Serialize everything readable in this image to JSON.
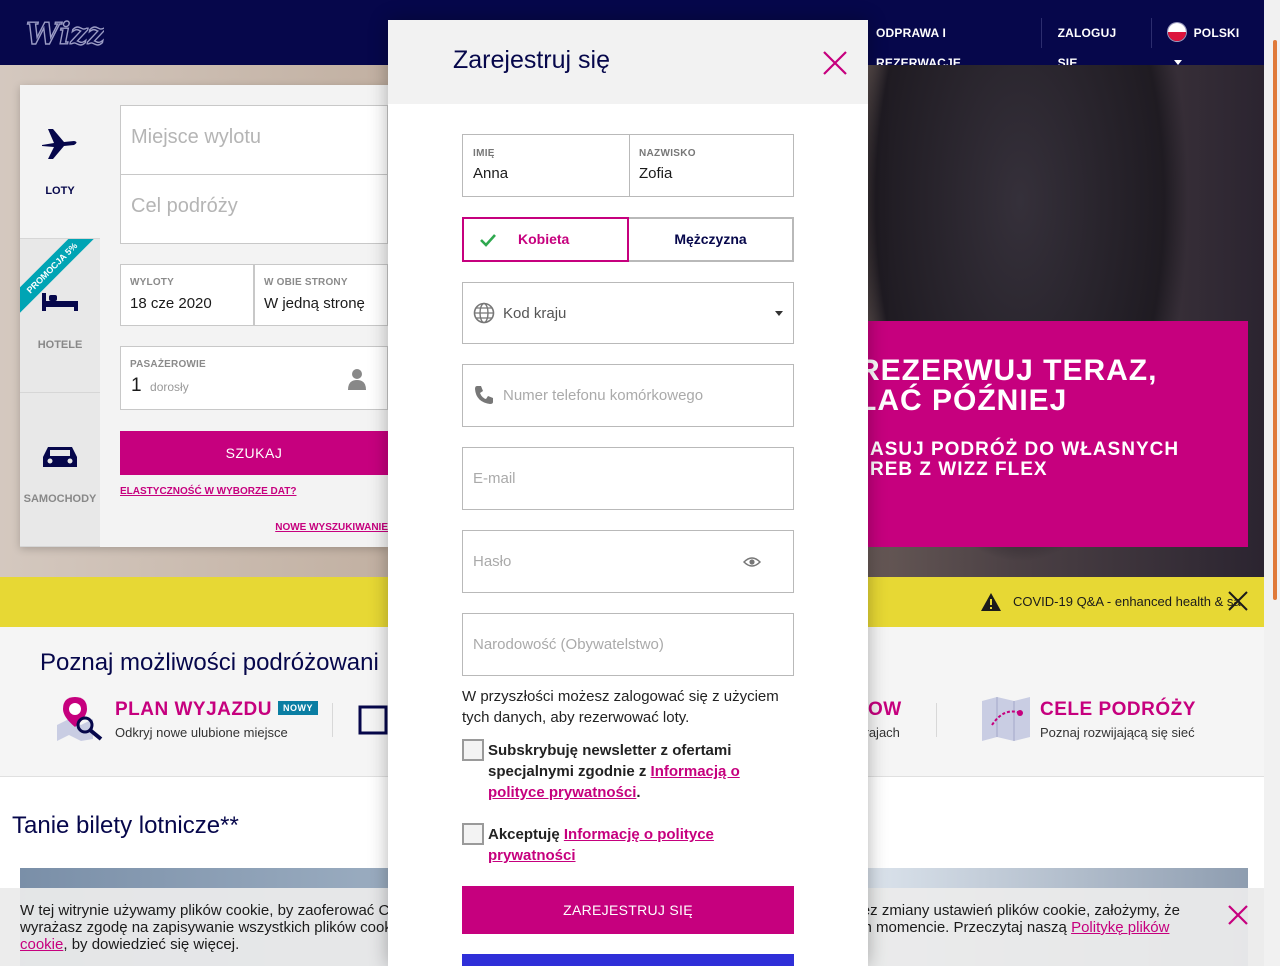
{
  "header": {
    "logo": "WIZZ",
    "nav": [
      "ODPRAWA I REZERWACJE",
      "ZALOGUJ SIĘ"
    ],
    "language": "POLSKI"
  },
  "search": {
    "tabs": [
      "LOTY",
      "HOTELE",
      "SAMOCHODY"
    ],
    "promo_ribbon": "PROMOCJA 5%",
    "origin_placeholder": "Miejsce wylotu",
    "destination_placeholder": "Cel podróży",
    "departures_label": "WYLOTY",
    "departures_value": "18 cze 2020",
    "trip_label": "W OBIE STRONY",
    "trip_value": "W jedną stronę",
    "passengers_label": "PASAŻEROWIE",
    "passengers_count": "1",
    "passengers_type": "dorosły",
    "search_button": "SZUKAJ",
    "flex_link": "ELASTYCZNOŚĆ W WYBORZE DAT?",
    "new_search_link": "NOWE WYSZUKIWANIE"
  },
  "promo": {
    "line1": "REZERWUJ TERAZ,",
    "line2": "LAĆ PÓŹNIEJ",
    "line3": "ASUJ PODRÓŻ DO WŁASNYCH",
    "line4": "REB Z WIZZ FLEX"
  },
  "covid": {
    "text": "COVID-19 Q&A - enhanced health & sa"
  },
  "options": {
    "heading": "Poznaj możliwości podróżowani",
    "items": [
      {
        "title": "PLAN WYJAZDU",
        "badge": "NOWY",
        "subtitle": "Odkryj nowe ulubione miejsce"
      },
      {
        "title": "OW",
        "subtitle": "krajach"
      },
      {
        "title": "CELE PODRÓŻY",
        "subtitle": "Poznaj rozwijającą się sieć"
      }
    ]
  },
  "cheap_tickets": {
    "heading": "Tanie bilety lotnicze**"
  },
  "cookie": {
    "text_before": "W tej witrynie używamy plików cookie, by zaoferować C",
    "text_mid": " bez zmiany ustawień plików cookie, założymy, że wyrażasz zgodę na zapisywanie wszystkich plików cook",
    "text_mid2": "ym momencie. Przeczytaj naszą ",
    "link1": "Politykę plików",
    "link2": "cookie",
    "text_after": ", by dowiedzieć się więcej."
  },
  "modal": {
    "title": "Zarejestruj się",
    "first_name_label": "IMIĘ",
    "first_name_value": "Anna",
    "last_name_label": "NAZWISKO",
    "last_name_value": "Zofia",
    "gender_female": "Kobieta",
    "gender_male": "Mężczyzna",
    "country_code_placeholder": "Kod kraju",
    "phone_placeholder": "Numer telefonu komórkowego",
    "email_placeholder": "E-mail",
    "password_placeholder": "Hasło",
    "nationality_placeholder": "Narodowość (Obywatelstwo)",
    "info_text": "W przyszłości możesz zalogować się z użyciem tych danych, aby rezerwować loty.",
    "newsletter_text": "Subskrybuję newsletter z ofertami specjalnymi zgodnie z ",
    "newsletter_link": "Informacją o polityce prywatności",
    "accept_text": "Akceptuję ",
    "accept_link": "Informację o polityce prywatności",
    "register_button": "ZAREJESTRUJ SIĘ"
  },
  "colors": {
    "brand_navy": "#06074b",
    "brand_magenta": "#c6007e",
    "covid_yellow": "#e7d834"
  }
}
